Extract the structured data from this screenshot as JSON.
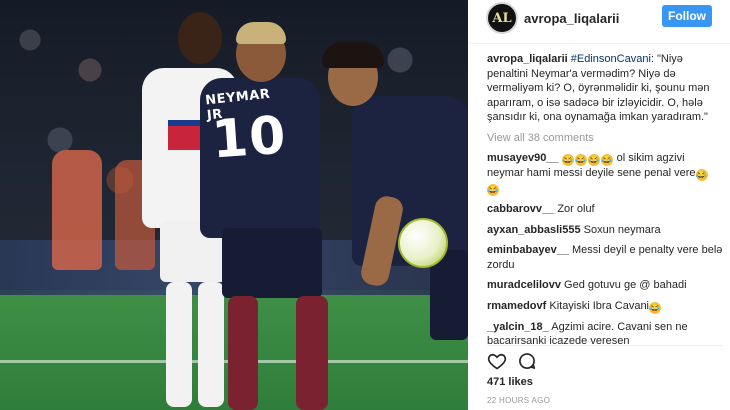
{
  "post": {
    "author": "avropa_liqalarii",
    "avatar_text": "AL",
    "follow_label": "Follow",
    "caption": {
      "author": "avropa_liqalarii",
      "tag": "#EdinsonCavani",
      "text": ": \"Niyə penaltini Neymar'a vermədim? Niyə də verməliyəm ki? O, öyrənməlidir ki, şounu mən aparıram, o isə sadəcə bir izləyicidir. O, hələ şansıdır ki, ona oynamağa imkan yaradıram.\""
    },
    "view_all_label": "View all 38 comments",
    "comments": [
      {
        "user": "musayev90__",
        "text": " ol sikim agzivi neymar hami messi deyile sene penal vere"
      },
      {
        "user": "cabbarovv__",
        "text": " Zor oluf"
      },
      {
        "user": "ayxan_abbasli555",
        "text": " Soxun neymara"
      },
      {
        "user": "eminbabayev__",
        "text": " Messi deyil e penalty vere  belə zordu"
      },
      {
        "user": "muradcelilovv",
        "text": " Ged gotuvu ge @ bahadi"
      },
      {
        "user": "rmamedovf",
        "text": " Kitayiski Ibra Cavani"
      },
      {
        "user": "_yalcin_18_",
        "text": " Agzimi acire. Cavani sen ne bacarirsanki icazede veresen"
      }
    ],
    "likes_label": "471 likes",
    "time_label": "22 HOURS AGO"
  },
  "photo": {
    "player_name": "NEYMAR JR",
    "player_number": "10"
  },
  "colors": {
    "follow_button": "#3897f0",
    "psg_navy": "#1b2340",
    "pitch_green": "#2f7d3a"
  },
  "icons": [
    "heart-icon",
    "comment-icon",
    "laughing-emoji-icon"
  ]
}
